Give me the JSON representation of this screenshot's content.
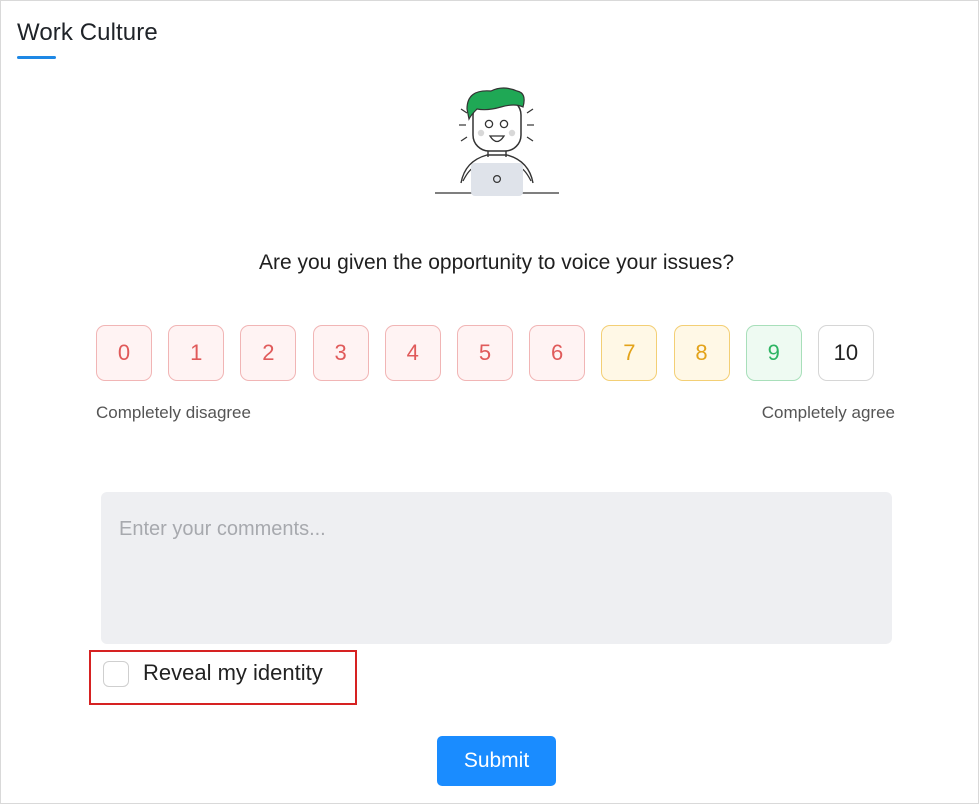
{
  "header": {
    "title": "Work Culture"
  },
  "survey": {
    "question": "Are you given the opportunity to voice your issues?",
    "scale": [
      {
        "value": "0",
        "tone": "red"
      },
      {
        "value": "1",
        "tone": "red"
      },
      {
        "value": "2",
        "tone": "red"
      },
      {
        "value": "3",
        "tone": "red"
      },
      {
        "value": "4",
        "tone": "red"
      },
      {
        "value": "5",
        "tone": "red"
      },
      {
        "value": "6",
        "tone": "red"
      },
      {
        "value": "7",
        "tone": "yellow"
      },
      {
        "value": "8",
        "tone": "yellow"
      },
      {
        "value": "9",
        "tone": "green"
      },
      {
        "value": "10",
        "tone": "neutral"
      }
    ],
    "label_min": "Completely disagree",
    "label_max": "Completely agree"
  },
  "comments": {
    "placeholder": "Enter your comments...",
    "value": ""
  },
  "reveal_identity": {
    "label": "Reveal my identity",
    "checked": false
  },
  "submit": {
    "label": "Submit"
  },
  "colors": {
    "accent": "#1a8cff",
    "title_underline": "#1e88e5",
    "highlight_box": "#d62222",
    "detractor": "#e05a5a",
    "passive": "#e3a31a",
    "promoter": "#2eb463",
    "illustration_hair": "#1fa855"
  },
  "icons": {
    "illustration": "happy-person-with-laptop-illustration"
  }
}
